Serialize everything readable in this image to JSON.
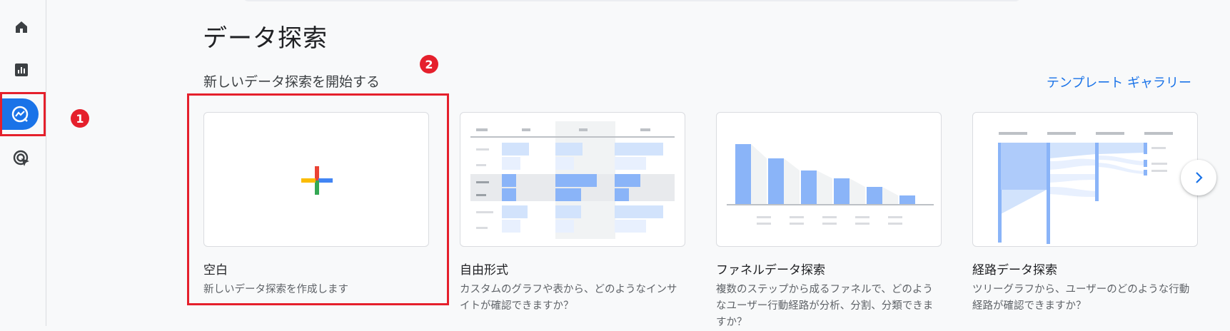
{
  "nav": {
    "items": [
      {
        "name": "home",
        "icon": "home-icon",
        "active": false
      },
      {
        "name": "reports",
        "icon": "bar-chart-icon",
        "active": false
      },
      {
        "name": "explore",
        "icon": "explore-icon",
        "active": true
      },
      {
        "name": "advertising",
        "icon": "ads-cursor-icon",
        "active": false
      }
    ]
  },
  "annotations": {
    "badge1": "1",
    "badge2": "2",
    "color": "#e5202c"
  },
  "header": {
    "title": "データ探索"
  },
  "section": {
    "title": "新しいデータ探索を開始する",
    "template_link": "テンプレート ギャラリー"
  },
  "cards": [
    {
      "title": "空白",
      "desc": "新しいデータ探索を作成します"
    },
    {
      "title": "自由形式",
      "desc": "カスタムのグラフや表から、どのようなインサイトが確認できますか？"
    },
    {
      "title": "ファネルデータ探索",
      "desc": "複数のステップから成るファネルで、どのようなユーザー行動経路が分析、分割、分類できますか？"
    },
    {
      "title": "経路データ探索",
      "desc": "ツリーグラフから、ユーザーのどのような行動経路が確認できますか？"
    }
  ],
  "colors": {
    "accent": "#1a73e8",
    "rail_bg": "#f8f9fa",
    "thumb_blue": "#8ab4f8",
    "thumb_light": "#d2e3fc"
  }
}
